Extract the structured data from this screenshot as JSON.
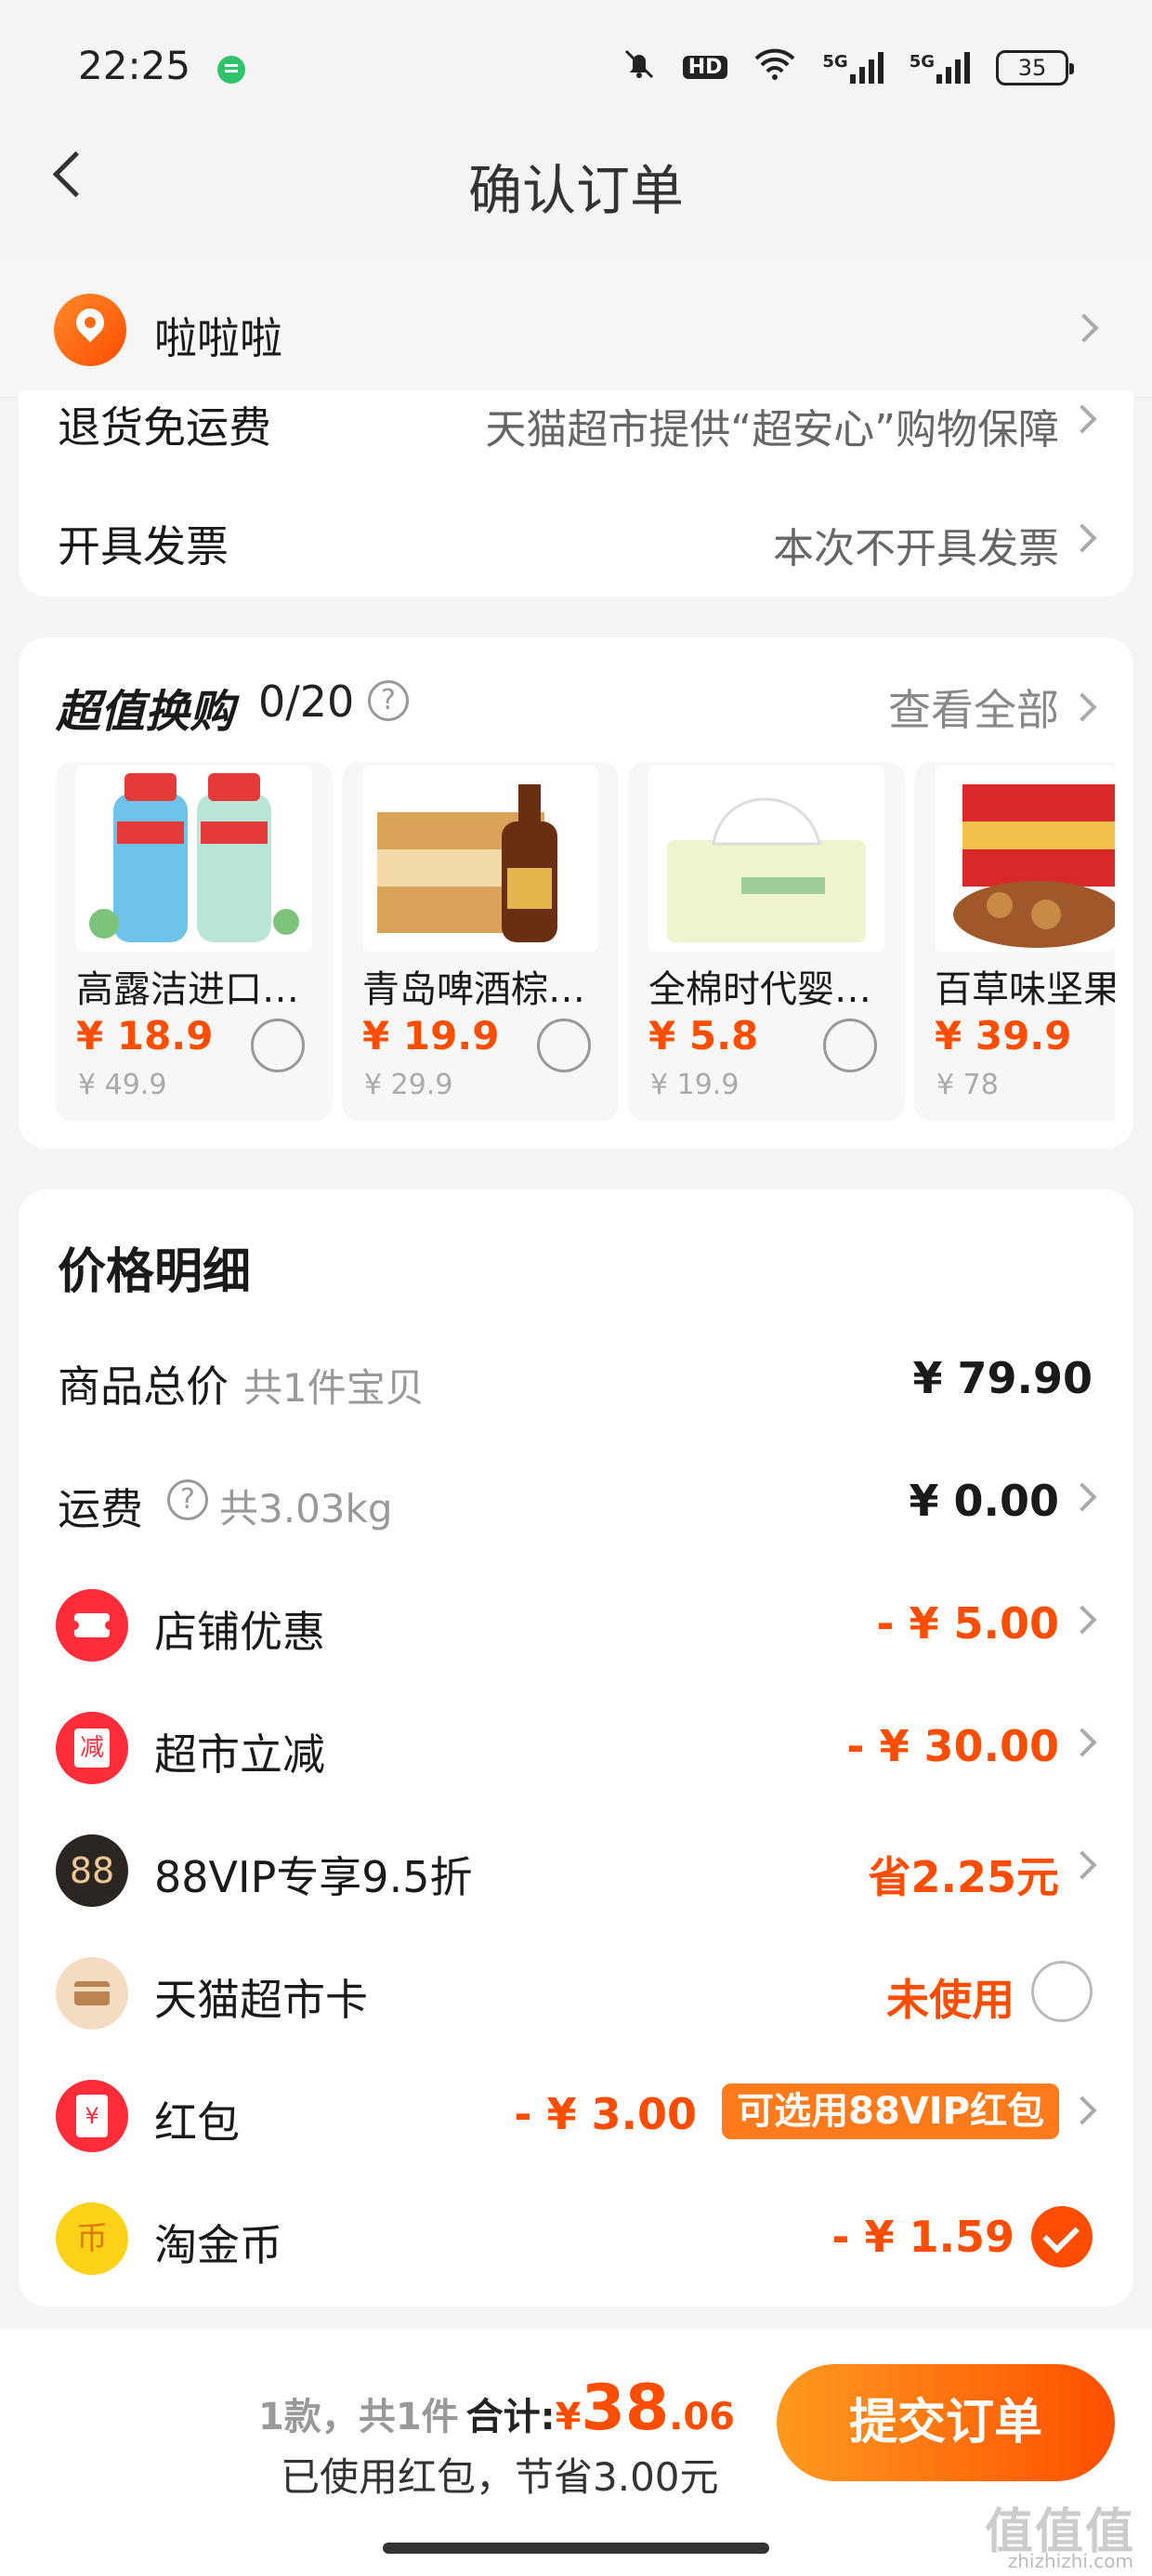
{
  "status_bar": {
    "time": "22:25",
    "hd": "HD",
    "net1": "5G",
    "net2": "5G",
    "battery": "35"
  },
  "nav": {
    "title": "确认订单"
  },
  "address": {
    "name": "啦啦啦"
  },
  "services": {
    "return": {
      "label": "退货免运费",
      "value": "天猫超市提供“超安心”购物保障"
    },
    "invoice": {
      "label": "开具发票",
      "value": "本次不开具发票"
    }
  },
  "swap": {
    "title": "超值换购",
    "count": "0/20",
    "view_all": "查看全部",
    "products": [
      {
        "name": "高露洁进口抑菌漱口水",
        "price": "¥ 18.9",
        "orig": "¥ 49.9",
        "image": "mouthwash-bottles"
      },
      {
        "name": "青岛啤酒棕金质啤酒",
        "price": "¥ 19.9",
        "orig": "¥ 29.9",
        "image": "tsingtao-beer"
      },
      {
        "name": "全棉时代婴儿棉柔巾",
        "price": "¥ 5.8",
        "orig": "¥ 19.9",
        "image": "cotton-tissue"
      },
      {
        "name": "百草味坚果礼盒",
        "price": "¥ 39.9",
        "orig": "¥ 78",
        "image": "nut-gift-box"
      }
    ]
  },
  "price_detail": {
    "title": "价格明细",
    "goods_total": {
      "label": "商品总价",
      "sub": "共1件宝贝",
      "value": "¥ 79.90"
    },
    "shipping": {
      "label": "运费",
      "sub": "共3.03kg",
      "value": "¥ 0.00"
    },
    "shop_discount": {
      "label": "店铺优惠",
      "value": "- ¥ 5.00",
      "icon": "coupon-icon"
    },
    "market_discount": {
      "label": "超市立减",
      "value": "- ¥ 30.00",
      "icon_text": "减"
    },
    "vip": {
      "label": "88VIP专享9.5折",
      "value": "省2.25元",
      "icon_text": "88"
    },
    "card": {
      "label": "天猫超市卡",
      "value": "未使用"
    },
    "red_packet": {
      "label": "红包",
      "value": "- ¥ 3.00",
      "badge": "可选用88VIP红包",
      "icon_text": "¥"
    },
    "coin": {
      "label": "淘金币",
      "value": "- ¥ 1.59",
      "icon_text": "币"
    }
  },
  "bottom": {
    "count": "1款，共1件",
    "total_label": "合计:",
    "currency": "¥",
    "total_int": "38",
    "total_dec": ".06",
    "saved": "已使用红包，节省3.00元",
    "submit": "提交订单"
  },
  "watermark": {
    "main": "值值值",
    "sub": "zhizhizhi.com"
  },
  "colors": {
    "accent": "#ff4d00",
    "background": "#f4f4f4"
  }
}
